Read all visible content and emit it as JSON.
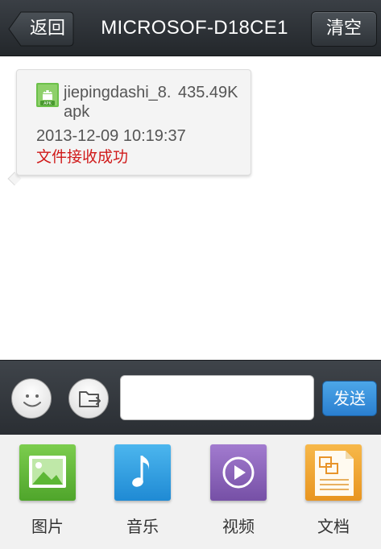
{
  "header": {
    "back_label": "返回",
    "title": "MICROSOF-D18CE1",
    "clear_label": "清空"
  },
  "message": {
    "icon": "apk-file-icon",
    "file_name": "jiepingdashi_8. apk",
    "file_size": "435.49K",
    "time": "2013-12-09 10:19:37",
    "status": "文件接收成功",
    "status_color": "#d01a1a"
  },
  "input_bar": {
    "emoji_icon": "smiley-icon",
    "file_icon": "send-file-icon",
    "text_value": "",
    "send_label": "发送",
    "send_color": "#2a7fd0"
  },
  "toolbar": {
    "items": [
      {
        "label": "图片",
        "icon": "image-icon",
        "color": "#5cb735"
      },
      {
        "label": "音乐",
        "icon": "music-note-icon",
        "color": "#2f9ee0"
      },
      {
        "label": "视频",
        "icon": "play-icon",
        "color": "#8a5fb8"
      },
      {
        "label": "文档",
        "icon": "document-icon",
        "color": "#f0a030"
      }
    ]
  }
}
